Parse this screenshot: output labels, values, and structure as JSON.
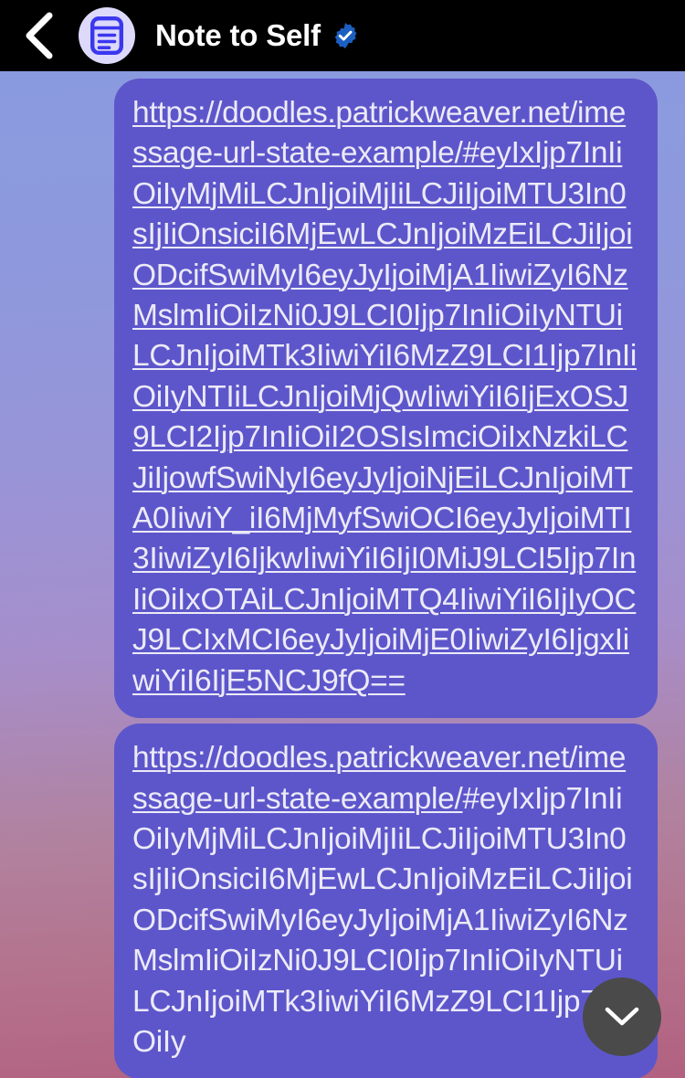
{
  "header": {
    "back_icon": "chevron-left-icon",
    "avatar_icon": "notes-document-icon",
    "title": "Note to Self",
    "verified_icon": "verified-badge-icon",
    "background_color": "#000000",
    "title_color": "#ffffff",
    "verified_color": "#1b5fc1",
    "avatar_bg_color": "#ddd9fb",
    "avatar_icon_color": "#3b37ef"
  },
  "conversation": {
    "background_gradient_top": "#8a9ade",
    "background_gradient_bottom": "#b26180",
    "bubble_color": "#5d56cb",
    "bubble_text_color": "#eceaf7",
    "messages": [
      {
        "id": "message-1",
        "link_part": "https://doodles.patrickweaver.net/imessage-url-state-example/",
        "fragment_part": "#eyIxIjp7InIiOiIyMjMiLCJnIjoiMjIiLCJiIjoiMTU3In0sIjIiOnsiciI6MjEwLCJnIjoiMzEiLCJiIjoiODcifSwiMyI6eyJyIjoiMjA1IiwiZyI6NzMslmIiOiIzNi0J9LCI0Ijp7InIiOiIyNTUiLCJnIjoiMTk3IiwiYiI6MzZ9LCI1Ijp7InIiOiIyNTIiLCJnIjoiMjQwIiwiYiI6IjExOSJ9LCI2Ijp7InIiOiI2OSIsImciOiIxNzkiLCJiIjowfSwiNyI6eyJyIjoiNjEiLCJnIjoiMTA0IiwiY_iI6MjMyfSwiOCI6eyJyIjoiMTI3IiwiZyI6IjkwIiwiYiI6IjI0MiJ9LCI5Ijp7InIiOiIxOTAiLCJnIjoiMTQ4IiwiYiI6IjIyOCJ9LCIxMCI6eyJyIjoiMjE0IiwiZyI6IjgxIiwiYiI6IjE5NCJ9fQ==",
        "whole_message_underlined": true
      },
      {
        "id": "message-2",
        "link_part": "https://doodles.patrickweaver.net/imessage-url-state-example/",
        "fragment_part": "#eyIxIjp7InIiOiIyMjMiLCJnIjoiMjIiLCJiIjoiMTU3In0sIjIiOnsiciI6MjEwLCJnIjoiMzEiLCJiIjoiODcifSwiMyI6eyJyIjoiMjA1IiwiZyI6NzMslmIiOiIzNi0J9LCI0Ijp7InIiOiIyNTUiLCJnIjoiMTk3IiwiYiI6MzZ9LCI1Ijp7InIiOiIy",
        "whole_message_underlined": false
      }
    ]
  },
  "scroll_to_bottom": {
    "icon": "chevron-down-icon",
    "background_color": "#4a4a4a",
    "icon_color": "#ffffff"
  }
}
